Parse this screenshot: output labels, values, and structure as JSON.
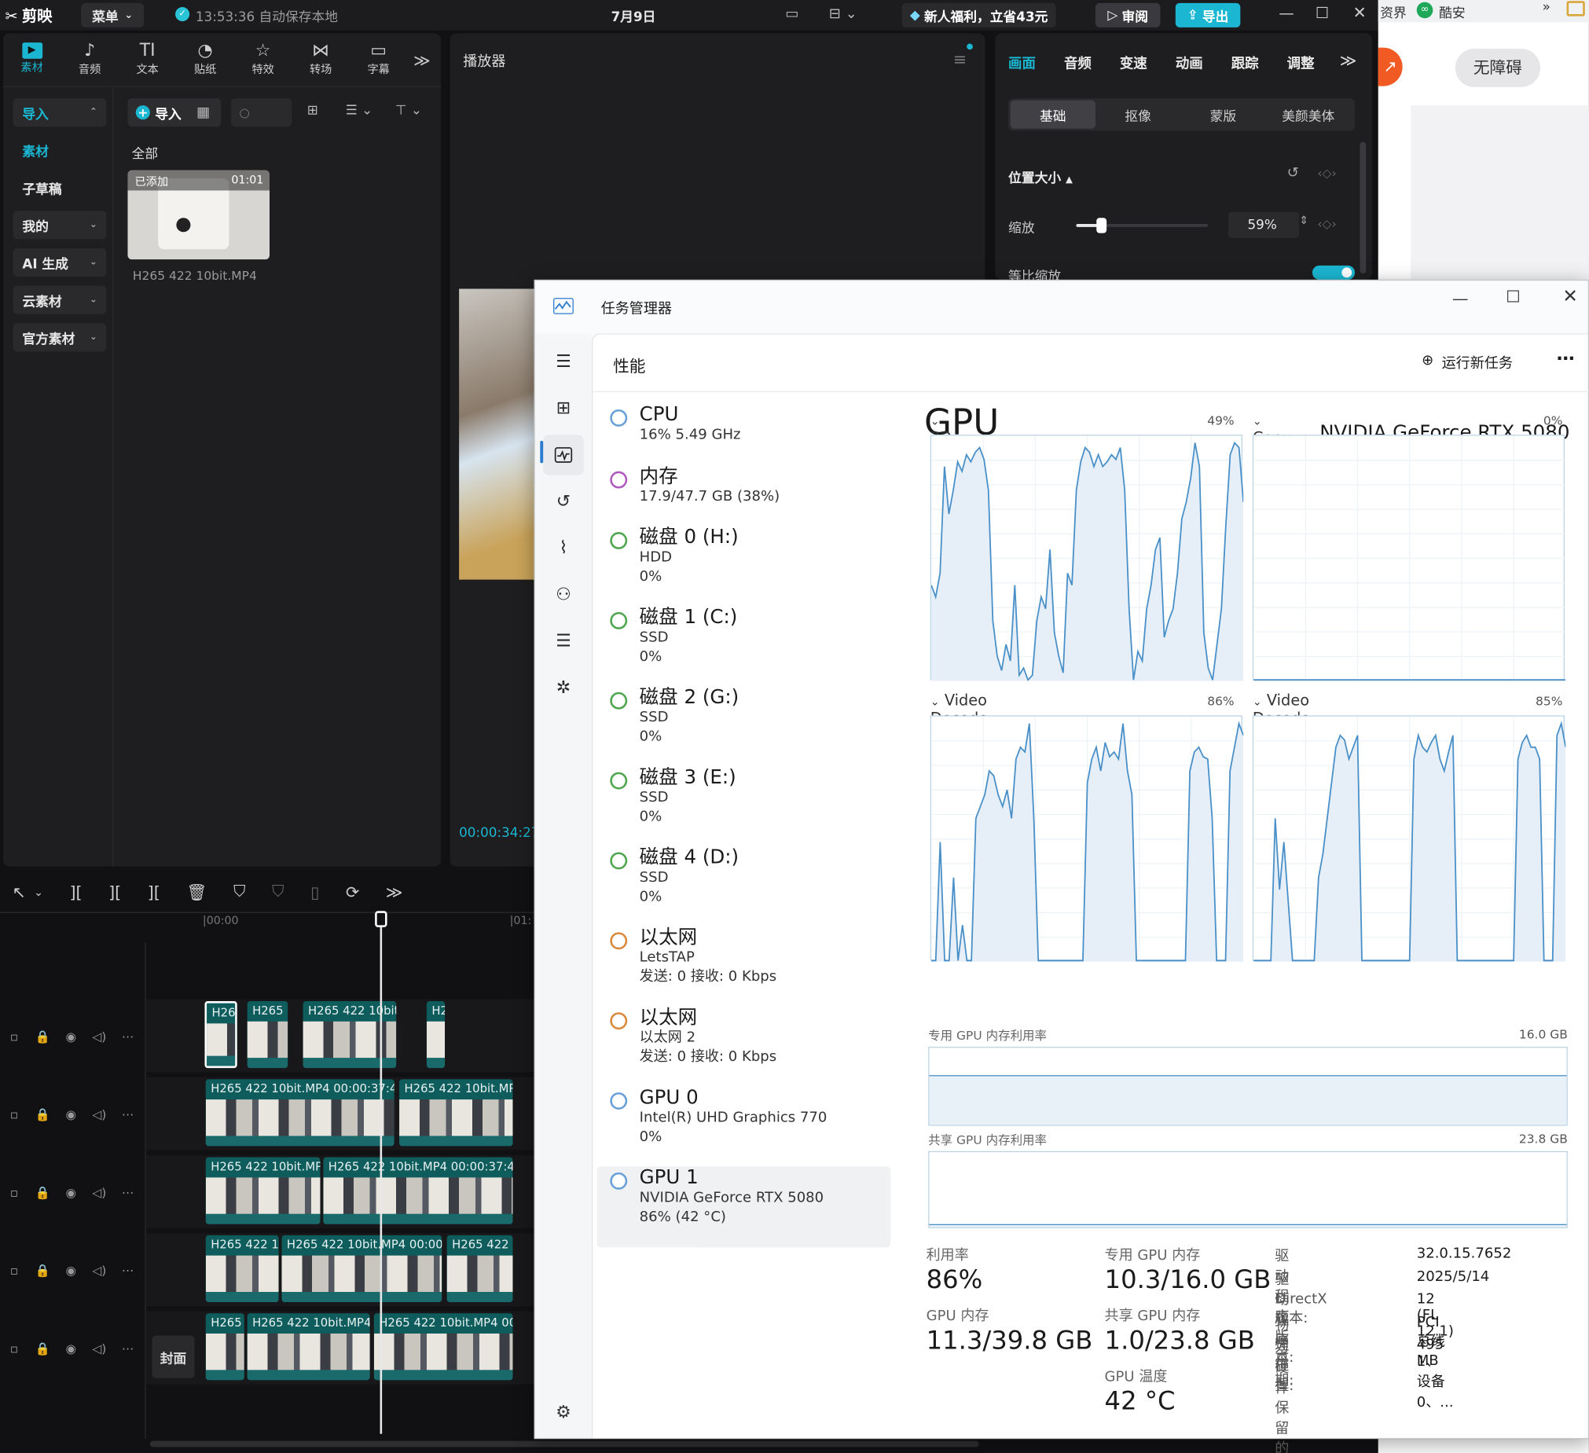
{
  "editor": {
    "app_name": "剪映",
    "menu_label": "菜单",
    "autosave_text": "13:53:36 自动保存本地",
    "date": "7月9日",
    "promo_text": "新人福利，立省43元",
    "review_label": "审阅",
    "export_label": "导出",
    "media_tabs": [
      "素材",
      "音频",
      "文本",
      "贴纸",
      "特效",
      "转场",
      "字幕"
    ],
    "media_tab_glyphs": [
      "▶",
      "♪",
      "TI",
      "◔",
      "☆",
      "⋈",
      "▭"
    ],
    "side_items": [
      {
        "label": "导入",
        "active": true
      },
      {
        "label": "素材",
        "active": false,
        "plain": true
      },
      {
        "label": "子草稿",
        "plain": true
      },
      {
        "label": "我的"
      },
      {
        "label": "AI 生成"
      },
      {
        "label": "云素材"
      },
      {
        "label": "官方素材"
      }
    ],
    "import_button": "导入",
    "all_label": "全部",
    "media_item": {
      "badge": "已添加",
      "duration": "01:01",
      "name": "H265 422 10bit.MP4"
    },
    "player_title": "播放器",
    "player_timecode": "00:00:34:27",
    "right_tabs": [
      "画面",
      "音频",
      "变速",
      "动画",
      "跟踪",
      "调整"
    ],
    "sub_tabs": [
      "基础",
      "抠像",
      "蒙版",
      "美颜美体"
    ],
    "section_title": "位置大小",
    "scale_label": "缩放",
    "scale_value": "59%",
    "scale_level": 0.59,
    "proportional_label": "等比缩放",
    "ruler_start": "00:00",
    "ruler_next": "01:",
    "cover_label": "封面",
    "tracks": [
      {
        "clips": [
          {
            "label": "H26",
            "selected": true
          },
          {
            "label": "H265"
          },
          {
            "label": "H265 422 10bit."
          },
          {
            "label": "H2"
          }
        ]
      },
      {
        "clips": [
          {
            "label": "H265 422 10bit.MP4  00:00:37:4"
          },
          {
            "label": "H265 422 10bit.MP"
          }
        ]
      },
      {
        "clips": [
          {
            "label": "H265 422 10bit.MP"
          },
          {
            "label": "H265 422 10bit.MP4  00:00:37:4"
          }
        ]
      },
      {
        "clips": [
          {
            "label": "H265 422 1("
          },
          {
            "label": "H265 422 10bit.MP4  00:00:"
          },
          {
            "label": "H265 422 "
          }
        ]
      },
      {
        "clips": [
          {
            "label": "H265"
          },
          {
            "label": "H265 422 10bit.MP4"
          },
          {
            "label": "H265 422 10bit.MP4  00"
          }
        ]
      }
    ]
  },
  "browser": {
    "tab1": "资界",
    "tab2": "酷安",
    "accessibility_button": "无障碍"
  },
  "taskmgr": {
    "title": "任务管理器",
    "section": "性能",
    "run_task": "运行新任务",
    "resources": [
      {
        "name": "CPU",
        "l1": "16%  5.49 GHz",
        "l2": "",
        "l3": "",
        "color": "#6aa0d8"
      },
      {
        "name": "内存",
        "l1": "17.9/47.7 GB (38%)",
        "l2": "",
        "l3": "",
        "color": "#b05cbf"
      },
      {
        "name": "磁盘 0 (H:)",
        "l1": "HDD",
        "l2": "0%",
        "l3": "",
        "color": "#4fa64f"
      },
      {
        "name": "磁盘 1 (C:)",
        "l1": "SSD",
        "l2": "0%",
        "l3": "",
        "color": "#4fa64f"
      },
      {
        "name": "磁盘 2 (G:)",
        "l1": "SSD",
        "l2": "0%",
        "l3": "",
        "color": "#4fa64f"
      },
      {
        "name": "磁盘 3 (E:)",
        "l1": "SSD",
        "l2": "0%",
        "l3": "",
        "color": "#4fa64f"
      },
      {
        "name": "磁盘 4 (D:)",
        "l1": "SSD",
        "l2": "0%",
        "l3": "",
        "color": "#4fa64f"
      },
      {
        "name": "以太网",
        "l1": "LetsTAP",
        "l2": "发送: 0 接收: 0 Kbps",
        "l3": "",
        "color": "#d98a3d"
      },
      {
        "name": "以太网",
        "l1": "以太网 2",
        "l2": "发送: 0 接收: 0 Kbps",
        "l3": "",
        "color": "#d98a3d"
      },
      {
        "name": "GPU 0",
        "l1": "Intel(R) UHD Graphics 770",
        "l2": "0%",
        "l3": "",
        "color": "#6aa0d8"
      },
      {
        "name": "GPU 1",
        "l1": "NVIDIA GeForce RTX 5080",
        "l2": "86% (42 °C)",
        "l3": "",
        "color": "#6aa0d8",
        "selected": true
      }
    ],
    "gpu_title": "GPU",
    "gpu_model": "NVIDIA GeForce RTX 5080",
    "graphs": [
      {
        "name": "3D",
        "value": "49%",
        "series": [
          40,
          35,
          45,
          90,
          70,
          80,
          92,
          88,
          95,
          92,
          96,
          98,
          93,
          80,
          25,
          10,
          4,
          15,
          8,
          40,
          2,
          5,
          0,
          2,
          25,
          35,
          30,
          55,
          20,
          10,
          3,
          45,
          40,
          80,
          92,
          98,
          96,
          90,
          95,
          90,
          92,
          95,
          93,
          98,
          80,
          30,
          0,
          12,
          8,
          30,
          40,
          55,
          60,
          18,
          25,
          30,
          45,
          68,
          75,
          85,
          100,
          90,
          20,
          5,
          0,
          15,
          30,
          65,
          95,
          100,
          98,
          75
        ]
      },
      {
        "name": "Copy",
        "value": "0%",
        "series": [
          0,
          0,
          0,
          0,
          0,
          0,
          0,
          0,
          0,
          0,
          0,
          0
        ]
      },
      {
        "name": "Video Decode 1",
        "value": "86%",
        "series": [
          0,
          0,
          50,
          0,
          0,
          35,
          0,
          15,
          0,
          0,
          60,
          65,
          70,
          80,
          78,
          70,
          65,
          72,
          60,
          85,
          90,
          88,
          100,
          60,
          0,
          0,
          0,
          0,
          0,
          0,
          0,
          0,
          0,
          0,
          0,
          75,
          85,
          90,
          80,
          92,
          86,
          88,
          85,
          100,
          80,
          70,
          0,
          0,
          0,
          0,
          0,
          0,
          0,
          0,
          0,
          0,
          0,
          0,
          80,
          88,
          90,
          86,
          85,
          60,
          0,
          0,
          0,
          80,
          90,
          100,
          95
        ]
      },
      {
        "name": "Video Decode",
        "value": "85%",
        "series": [
          0,
          0,
          0,
          0,
          0,
          60,
          30,
          50,
          25,
          0,
          0,
          0,
          0,
          0,
          0,
          35,
          45,
          60,
          75,
          90,
          95,
          93,
          85,
          90,
          95,
          0,
          0,
          0,
          0,
          0,
          0,
          0,
          0,
          0,
          0,
          0,
          0,
          85,
          95,
          90,
          88,
          92,
          95,
          85,
          80,
          88,
          95,
          0,
          0,
          0,
          0,
          0,
          0,
          0,
          0,
          0,
          0,
          0,
          0,
          0,
          0,
          85,
          92,
          95,
          90,
          90,
          85,
          0,
          0,
          0,
          95,
          100,
          90
        ]
      }
    ],
    "dedicated_mem_label": "专用 GPU 内存利用率",
    "dedicated_mem_max": "16.0 GB",
    "dedicated_mem_level": 0.64,
    "shared_mem_label": "共享 GPU 内存利用率",
    "shared_mem_max": "23.8 GB",
    "shared_mem_level": 0.04,
    "stats": {
      "util_label": "利用率",
      "util_value": "86%",
      "gpu_mem_label": "GPU 内存",
      "gpu_mem_value": "11.3/39.8 GB",
      "ded_label": "专用 GPU 内存",
      "ded_value": "10.3/16.0 GB",
      "shared_label": "共享 GPU 内存",
      "shared_value": "1.0/23.8 GB",
      "temp_label": "GPU 温度",
      "temp_value": "42 °C"
    },
    "info": [
      {
        "k": "驱动程序版本:",
        "v": "32.0.15.7652"
      },
      {
        "k": "驱动程序日期:",
        "v": "2025/5/14"
      },
      {
        "k": "DirectX 版本:",
        "v": "12 (FL 12.1)"
      },
      {
        "k": "物理位置:",
        "v": "PCI 总线 1、设备 0、..."
      },
      {
        "k": "为硬件保留的内存:",
        "v": "495 MB"
      }
    ]
  }
}
